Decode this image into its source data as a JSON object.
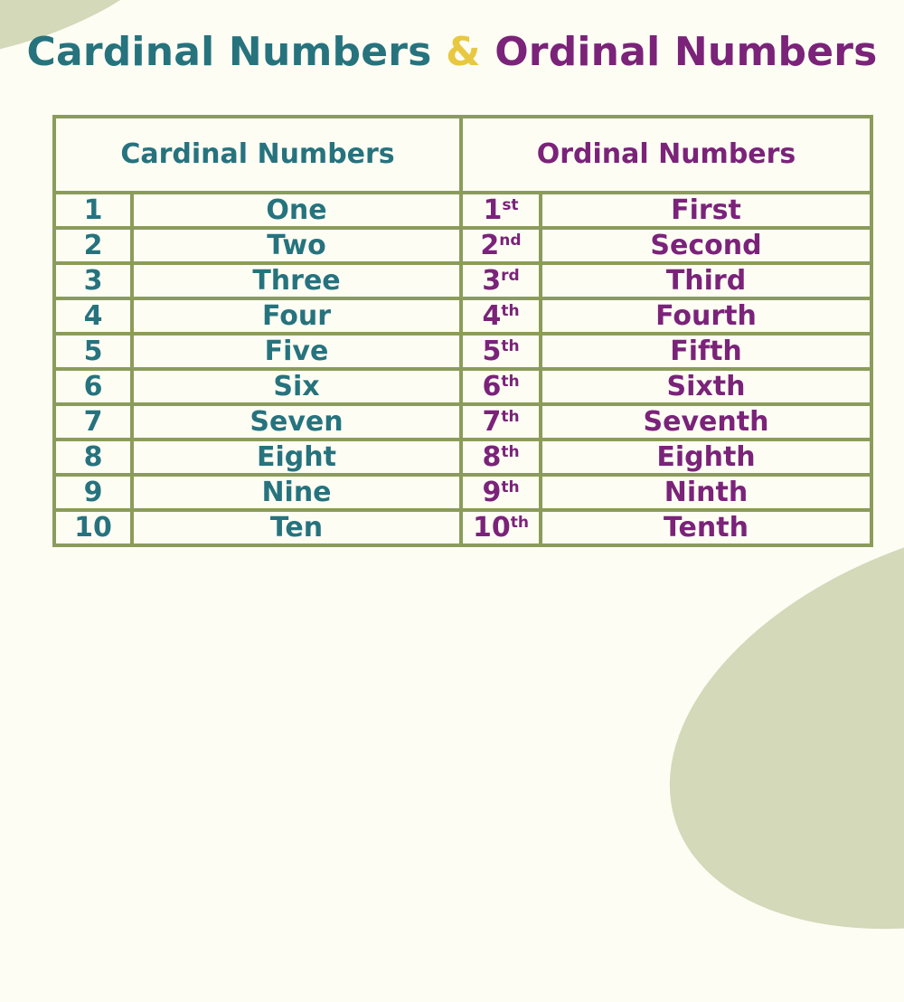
{
  "title": {
    "part1": "Cardinal Numbers",
    "ampersand": "&",
    "part2": "Ordinal Numbers"
  },
  "colors": {
    "cardinal": "#26737e",
    "ordinal": "#7a2379",
    "ampersand": "#e8c840",
    "grid": "#8b9c5a",
    "background": "#fdfdf4",
    "decor": "#d3d9b9"
  },
  "table": {
    "headers": {
      "cardinal": "Cardinal Numbers",
      "ordinal": "Ordinal Numbers"
    },
    "rows": [
      {
        "num": "1",
        "word": "One",
        "ord": "1",
        "suffix": "st",
        "oword": "First"
      },
      {
        "num": "2",
        "word": "Two",
        "ord": "2",
        "suffix": "nd",
        "oword": "Second"
      },
      {
        "num": "3",
        "word": "Three",
        "ord": "3",
        "suffix": "rd",
        "oword": "Third"
      },
      {
        "num": "4",
        "word": "Four",
        "ord": "4",
        "suffix": "th",
        "oword": "Fourth"
      },
      {
        "num": "5",
        "word": "Five",
        "ord": "5",
        "suffix": "th",
        "oword": "Fifth"
      },
      {
        "num": "6",
        "word": "Six",
        "ord": "6",
        "suffix": "th",
        "oword": "Sixth"
      },
      {
        "num": "7",
        "word": "Seven",
        "ord": "7",
        "suffix": "th",
        "oword": "Seventh"
      },
      {
        "num": "8",
        "word": "Eight",
        "ord": "8",
        "suffix": "th",
        "oword": "Eighth"
      },
      {
        "num": "9",
        "word": "Nine",
        "ord": "9",
        "suffix": "th",
        "oword": "Ninth"
      },
      {
        "num": "10",
        "word": "Ten",
        "ord": "10",
        "suffix": "th",
        "oword": "Tenth"
      }
    ]
  }
}
